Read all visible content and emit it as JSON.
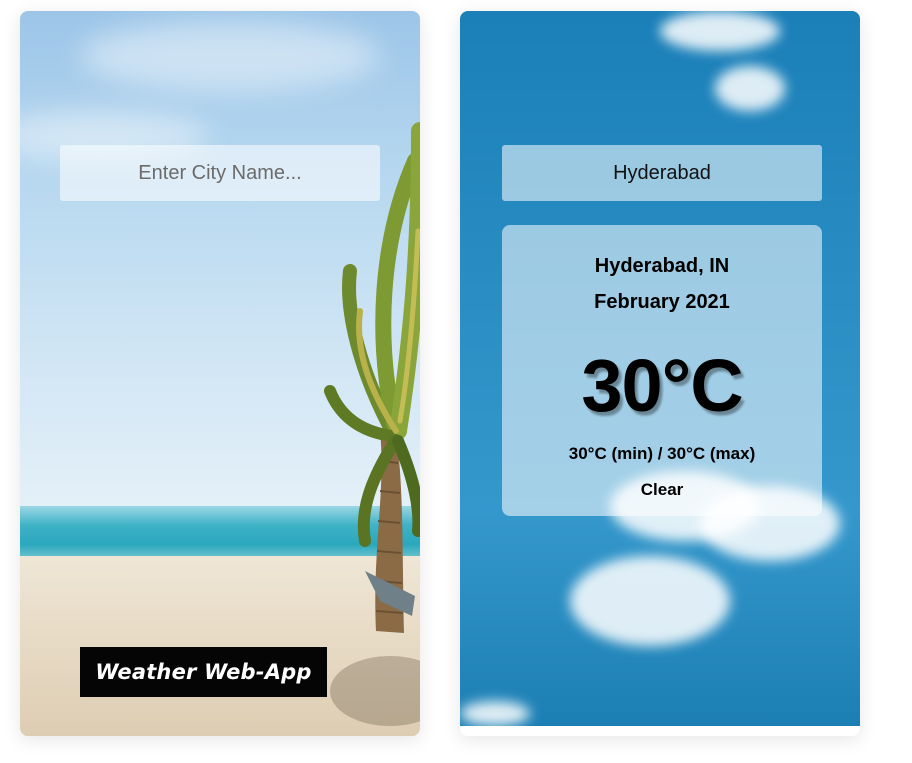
{
  "left_card": {
    "search_placeholder": "Enter City Name...",
    "app_title": "Weather Web-App"
  },
  "right_card": {
    "search_value": "Hyderabad",
    "weather": {
      "location": "Hyderabad, IN",
      "date": "February 2021",
      "temperature": "30°C",
      "min_max": "30°C (min) / 30°C (max)",
      "description": "Clear"
    }
  },
  "colors": {
    "title_bg": "#050505",
    "sky_blue": "#2a8ec4",
    "sea": "#2ba7bd",
    "sand": "#e7dac4"
  }
}
